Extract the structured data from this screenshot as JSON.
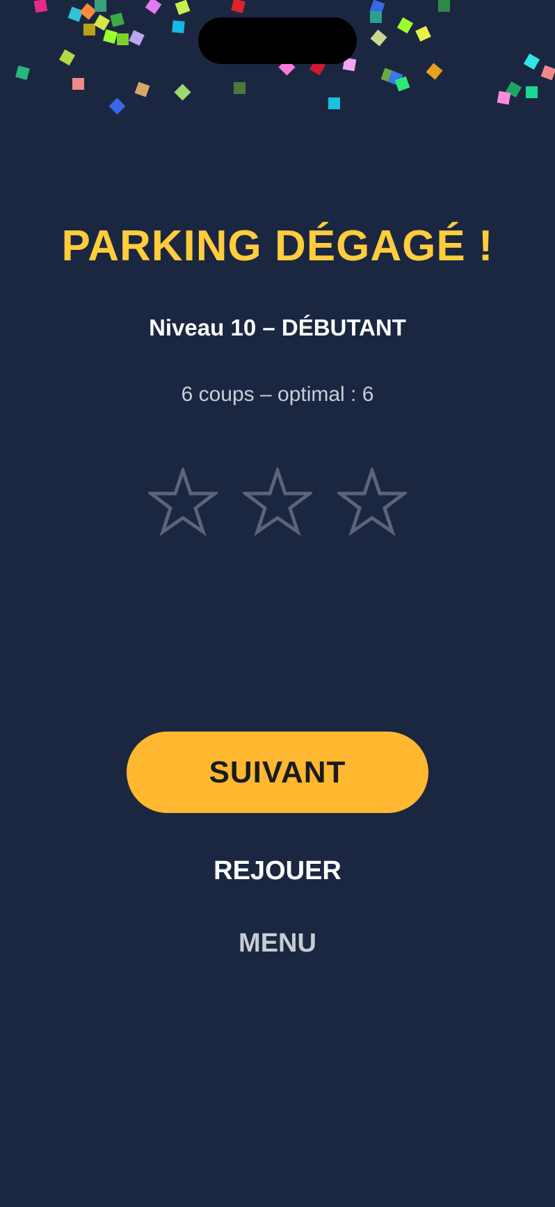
{
  "result": {
    "title": "PARKING DÉGAGÉ !",
    "subtitle": "Niveau 10 – DÉBUTANT",
    "moves_text": "6 coups – optimal : 6",
    "stars_earned": 0,
    "stars_total": 3
  },
  "actions": {
    "next_label": "SUIVANT",
    "replay_label": "REJOUER",
    "menu_label": "MENU"
  },
  "colors": {
    "background": "#1b2740",
    "title": "#ffcc3d",
    "primary_button": "#ffb830",
    "star_outline": "#5b6577"
  }
}
